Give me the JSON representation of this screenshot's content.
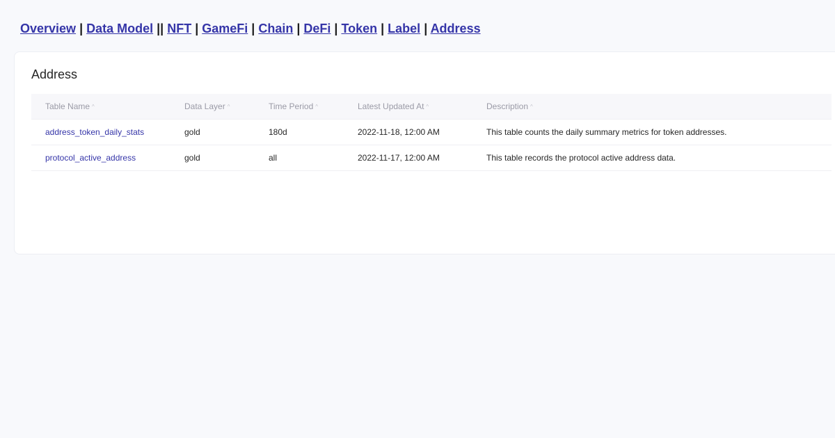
{
  "nav": {
    "overview": "Overview",
    "sep1": " | ",
    "data_model": "Data Model",
    "sep2": " || ",
    "nft": "NFT",
    "sep3": " | ",
    "gamefi": "GameFi",
    "sep4": " | ",
    "chain": "Chain",
    "sep5": " | ",
    "defi": "DeFi",
    "sep6": " | ",
    "token": "Token",
    "sep7": " | ",
    "label": "Label",
    "sep8": " | ",
    "address": "Address"
  },
  "card": {
    "title": "Address"
  },
  "table": {
    "columns": [
      "Table Name",
      "Data Layer",
      "Time Period",
      "Latest Updated At",
      "Description"
    ],
    "sort_icon": "sort-asc-icon",
    "sort_glyph": "^",
    "rows": [
      {
        "name": "address_token_daily_stats",
        "layer": "gold",
        "period": "180d",
        "updated": "2022-11-18, 12:00 AM",
        "description": "This table counts the daily summary metrics for token addresses."
      },
      {
        "name": "protocol_active_address",
        "layer": "gold",
        "period": "all",
        "updated": "2022-11-17, 12:00 AM",
        "description": "This table records the protocol active address data."
      }
    ]
  },
  "colors": {
    "link": "#3535a8",
    "background": "#f8f9fc",
    "header_bg": "#f7f7fa"
  }
}
